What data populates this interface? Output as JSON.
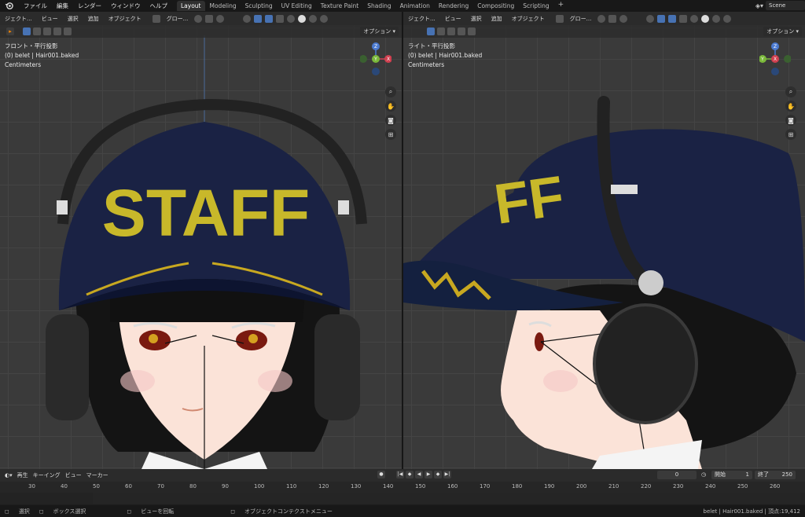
{
  "topbar": {
    "menu": [
      "ファイル",
      "編集",
      "レンダー",
      "ウィンドウ",
      "ヘルプ"
    ],
    "tabs": [
      "Layout",
      "Modeling",
      "Sculpting",
      "UV Editing",
      "Texture Paint",
      "Shading",
      "Animation",
      "Rendering",
      "Compositing",
      "Scripting"
    ],
    "active_tab": "Layout",
    "scene_label": "Scene"
  },
  "left_viewport": {
    "mode": "ジェクト...",
    "menu": [
      "ビュー",
      "選択",
      "追加",
      "オブジェクト"
    ],
    "transform": "グロー...",
    "options": "オプション",
    "view_name": "フロント・平行投影",
    "object": "(0) belet | Hair001.baked",
    "units": "Centimeters",
    "cap_text": "STAFF"
  },
  "right_viewport": {
    "mode": "ジェクト...",
    "menu": [
      "ビュー",
      "選択",
      "追加",
      "オブジェクト"
    ],
    "transform": "グロー...",
    "options": "オプション",
    "view_name": "ライト・平行投影",
    "object": "(0) belet | Hair001.baked",
    "units": "Centimeters",
    "cap_text": "FF"
  },
  "gizmo": {
    "z": "Z",
    "y": "Y",
    "x": "X"
  },
  "timeline": {
    "menu": [
      "再生",
      "キーイング",
      "ビュー",
      "マーカー"
    ],
    "current_frame": "0",
    "start_label": "開始",
    "start": "1",
    "end_label": "終了",
    "end": "250",
    "ticks": [
      "30",
      "40",
      "50",
      "60",
      "70",
      "80",
      "90",
      "100",
      "110",
      "120",
      "130",
      "140",
      "150",
      "160",
      "170",
      "180",
      "190",
      "200",
      "210",
      "220",
      "230",
      "240",
      "250",
      "260"
    ]
  },
  "status": {
    "select": "選択",
    "box": "ボックス選択",
    "rotate": "ビューを回転",
    "context": "オブジェクトコンテクストメニュー",
    "info": "belet | Hair001.baked | 頂点:19,412"
  },
  "colors": {
    "accent": "#4772b3",
    "cap": "#1a2244",
    "staff": "#c8b82a"
  }
}
